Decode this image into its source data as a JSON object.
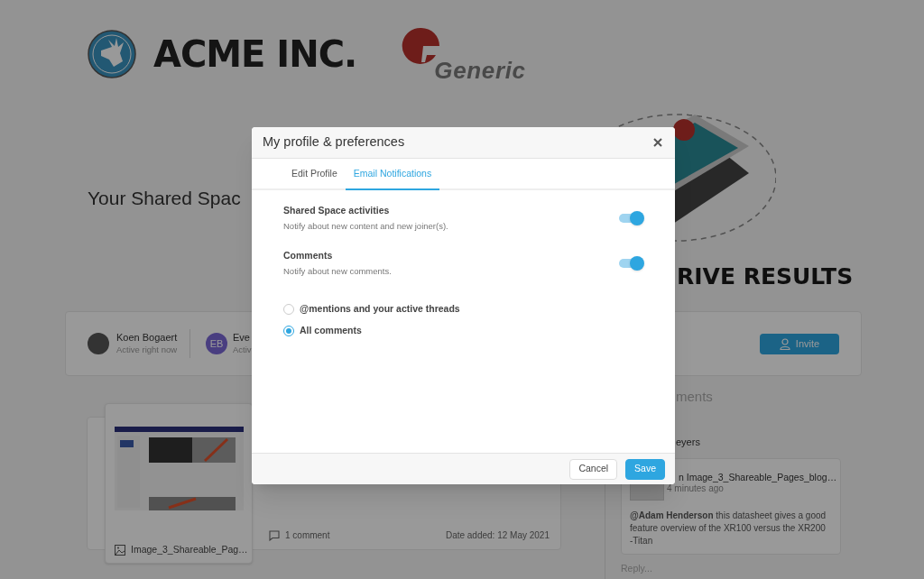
{
  "logos": [
    {
      "text": "ACME INC.",
      "kind": "acme"
    },
    {
      "text": "Generic",
      "kind": "generic"
    }
  ],
  "page_title": "Your Shared Spac",
  "hero_caption": "RIVE RESULTS",
  "members": [
    {
      "kind": "photo",
      "name": "Koen Bogaert",
      "status": "Active right now"
    },
    {
      "kind": "initials",
      "initials": "EB",
      "name": "Eve",
      "status": "Activ"
    }
  ],
  "invite_button": "Invite",
  "file_card": {
    "name": "Image_3_Shareable_Pag…",
    "comments": "1 comment",
    "date": "Date added: 12 May 2021"
  },
  "comments_panel": {
    "heading": "ments",
    "author": "eyers",
    "comment": {
      "file": "n Image_3_Shareable_Pages_blog…",
      "time": "4 minutes ago",
      "text": "**@Adam Henderson** this datasheet gives a good feature overview of the XR100 versus the XR200 -Titan"
    },
    "reply_placeholder": "Reply..."
  },
  "dialog": {
    "title": "My profile & preferences",
    "tabs": [
      {
        "label": "Edit Profile",
        "selected": false
      },
      {
        "label": "Email Notifications",
        "selected": true
      }
    ],
    "settings": [
      {
        "title": "Shared Space activities",
        "description": "Notify about new content and new joiner(s).",
        "on": true
      },
      {
        "title": "Comments",
        "description": "Notify about new comments.",
        "on": true
      }
    ],
    "options": [
      {
        "label": "@mentions and your active threads",
        "selected": false
      },
      {
        "label": "All comments",
        "selected": true
      }
    ],
    "buttons": [
      {
        "label": "Cancel",
        "kind": "secondary"
      },
      {
        "label": "Save",
        "kind": "primary"
      }
    ]
  }
}
